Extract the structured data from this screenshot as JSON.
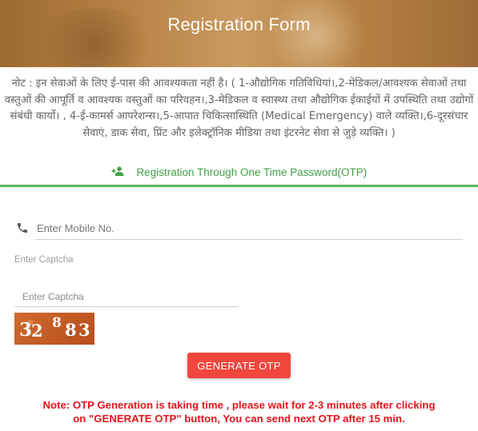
{
  "header": {
    "title": "Registration Form"
  },
  "note": {
    "text": "नोट : इन सेवाओं के लिए ई-पास की आवश्यकता नहीं है। ( 1-औद्योगिक गतिविधियां।,2-मेडिकल/आवश्यक सेवाओं तथा वस्तुओं की आपूर्ति व आवश्यक वस्तुओं का परिवहन।,3-मेडिकल व स्वास्थ्य तथा औद्योगिक ईकाईयों में उपस्थिति तथा उद्योगों संबंधी कार्यो। , 4-ई-कामर्स आपरेशन्स।,5-आपात चिकित्सास्थिति (Medical Emergency) वाले व्यक्ति।,6-दूरसंचार सेवाएं, डाक सेवा, प्रिंट और इलेक्ट्रॉनिक मीडिया तथा इंटरनेट सेवा से जुड़े व्यक्ति। )"
  },
  "otp_tab": {
    "icon": "person-add-icon",
    "label": "Registration Through One Time Password(OTP)",
    "color": "#43a047"
  },
  "form": {
    "mobile": {
      "icon": "phone-icon",
      "value": "",
      "placeholder": "Enter Mobile No."
    },
    "captcha_label": "Enter Captcha",
    "captcha_input": {
      "value": "",
      "placeholder": "Enter Captcha"
    },
    "captcha_image_text": "32883",
    "generate_button": "GENERATE OTP"
  },
  "warning": {
    "line1": "Note: OTP Generation is taking time , please wait for 2-3 minutes after clicking",
    "line2": "on \"GENERATE OTP\" button, You can send next OTP after 15 min.",
    "color": "#e5141b"
  },
  "colors": {
    "accent_green": "#5cb85c",
    "button_red": "#f0463d",
    "header_brown": "#b98446"
  }
}
